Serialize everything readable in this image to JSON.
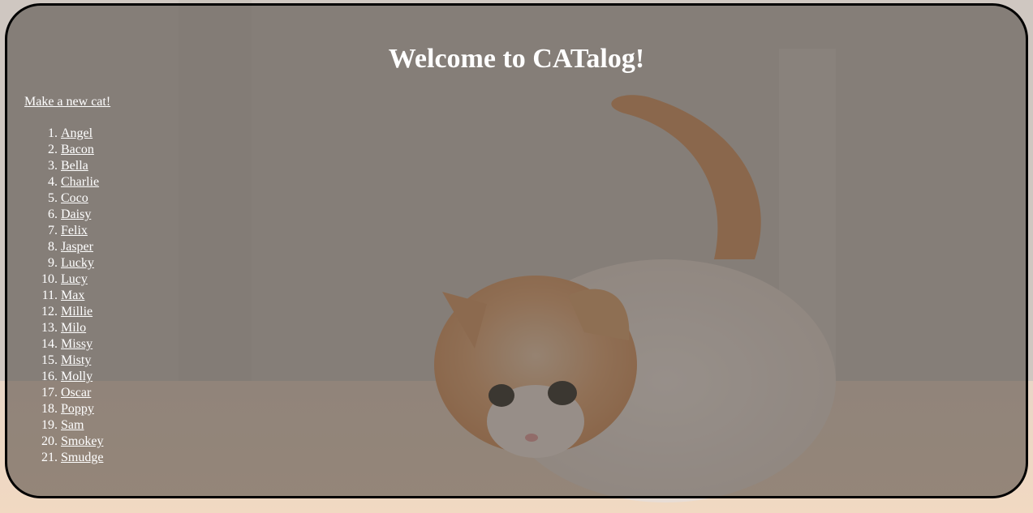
{
  "page": {
    "title": "Welcome to CATalog!",
    "new_cat_link": "Make a new cat!"
  },
  "cats": [
    "Angel",
    "Bacon",
    "Bella",
    "Charlie",
    "Coco",
    "Daisy",
    "Felix",
    "Jasper",
    "Lucky",
    "Lucy",
    "Max",
    "Millie",
    "Milo",
    "Missy",
    "Misty",
    "Molly",
    "Oscar",
    "Poppy",
    "Sam",
    "Smokey",
    "Smudge"
  ],
  "colors": {
    "overlay": "#48413c",
    "text": "#ffffff",
    "border": "#000000"
  }
}
